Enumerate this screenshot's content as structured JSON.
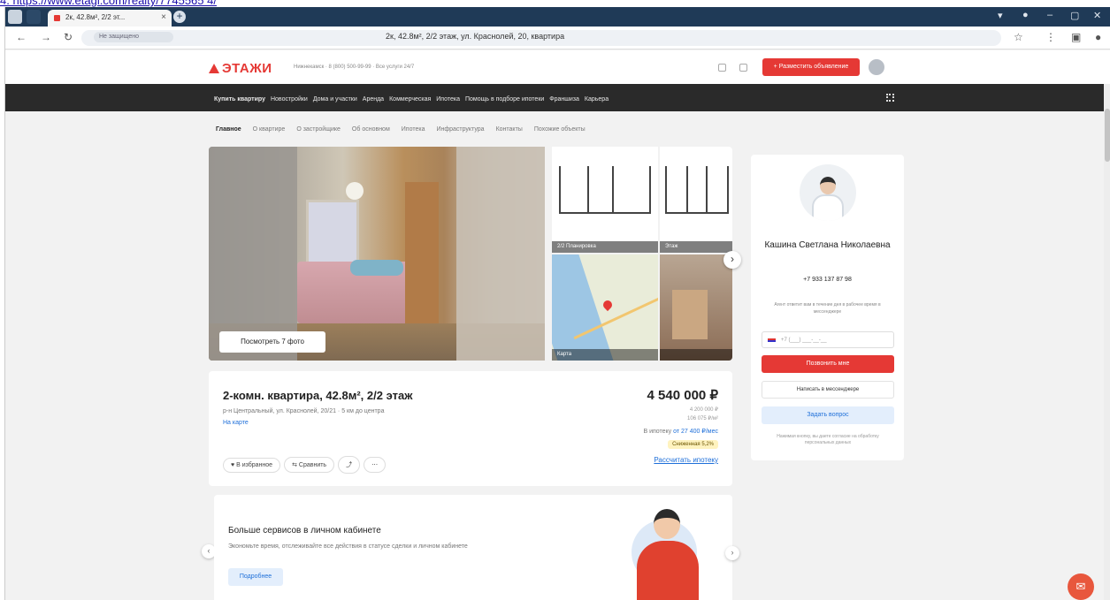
{
  "top_link": "4. https://www.etagi.com/realty/7745565 4/",
  "browser": {
    "tab_title": "2к, 42.8м², 2/2 эт...",
    "url_chip": "Не защищено",
    "page_title": "2к, 42.8м², 2/2 этаж, ул. Краснолей, 20, квартира"
  },
  "site": {
    "logo": "ЭТАЖИ",
    "city": "Нижнекамск · 8 (800) 500-99-99 · Все услуги 24/7",
    "post_button": "+ Разместить объявление"
  },
  "menu": [
    "Купить квартиру",
    "Новостройки",
    "Дома и участки",
    "Аренда",
    "Коммерческая",
    "Ипотека",
    "Помощь в подборе ипотеки",
    "Франшиза",
    "Карьера"
  ],
  "subnav": [
    "Главное",
    "О квартире",
    "О застройщике",
    "Об основном",
    "Ипотека",
    "Инфраструктура",
    "Контакты",
    "Похожие объекты"
  ],
  "gallery": {
    "show_photos": "Посмотреть 7 фото",
    "plan1_caption": "2/2 Планировка",
    "plan2_caption": "Этаж",
    "map_caption": "Карта"
  },
  "listing": {
    "title": "2-комн. квартира, 42.8м², 2/2 этаж",
    "address": "р-н Центральный, ул. Краснолей, 20/21 · 5 км до центра",
    "map_link": "На карте",
    "price": "4 540 000 ₽",
    "price_sub1": "4 200 000 ₽",
    "price_sub2": "106 075 ₽/м²",
    "mortgage_label": "В ипотеку",
    "mortgage_value": "от 27 400 ₽/мес",
    "badge": "Сниженная 5,2%",
    "calc_link": "Рассчитать ипотеку",
    "actions": [
      "♥ В избранное",
      "⇆ Сравнить",
      "⤴",
      "⋯"
    ]
  },
  "promo": {
    "title": "Больше сервисов в личном кабинете",
    "subtitle": "Экономьте время, отслеживайте все действия в статусе сделки и личном кабинете",
    "button": "Подробнее"
  },
  "agent": {
    "name": "Кашина Светлана Николаевна",
    "phone": "+7 933 137 87 98",
    "note": "Агент ответит вам в течение дня в рабочее время в мессенджере",
    "phone_placeholder": "+7 (___) ___-__-__",
    "call_button": "Позвонить мне",
    "write_button": "Написать в мессенджере",
    "chat_button": "Задать вопрос",
    "disclaimer": "Нажимая кнопку, вы даете согласие на обработку персональных данных"
  },
  "icons": {
    "tab_favicon": "etagi-favicon",
    "chat": "chat-icon",
    "gallery_next": "chevron-right-icon"
  },
  "colors": {
    "brand_red": "#e53935",
    "menu_bg": "#2a2a2a",
    "link_blue": "#1e6fd9"
  }
}
